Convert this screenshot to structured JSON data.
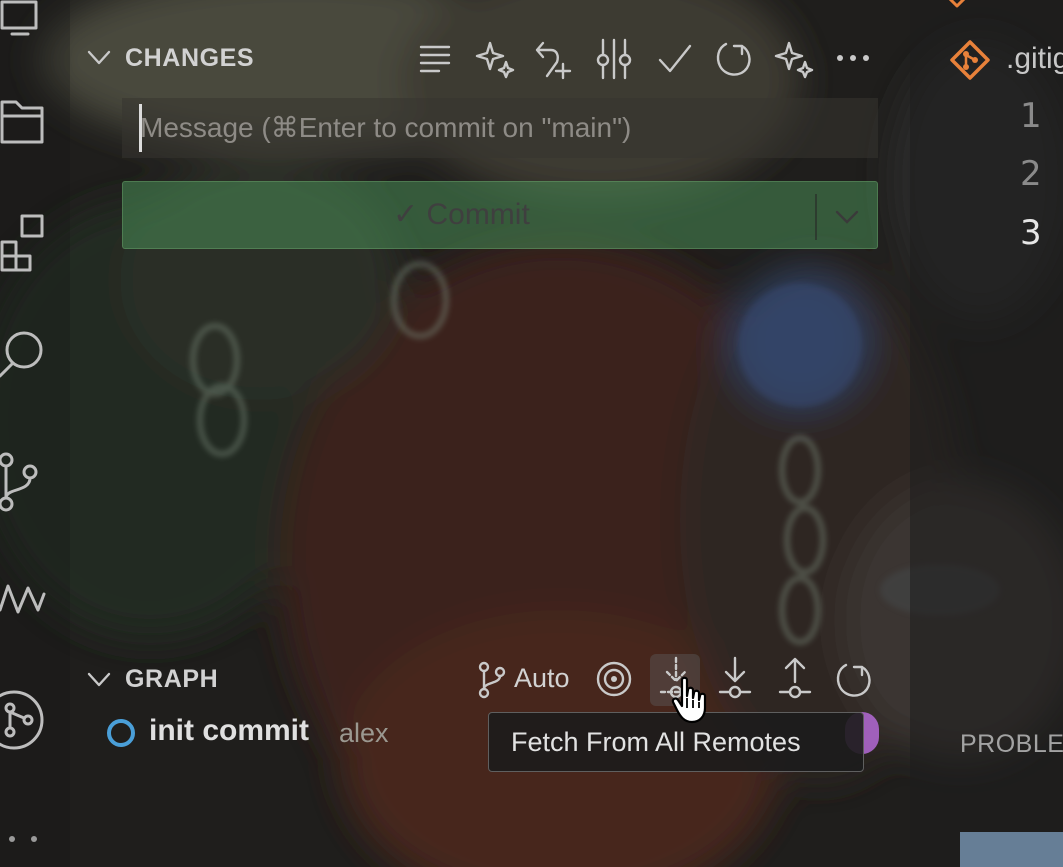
{
  "changes": {
    "title": "CHANGES",
    "toolbar_icons": [
      "list-flat-icon",
      "sparkle-icon",
      "discard-icon",
      "stage-commit-icon",
      "checkmark-icon",
      "refresh-icon",
      "sparkle-icon",
      "more-icon"
    ],
    "message_placeholder": "Message (⌘Enter to commit on \"main\")",
    "commit_label": "✓ Commit"
  },
  "graph": {
    "title": "GRAPH",
    "branch_mode": "Auto",
    "commits": [
      {
        "message": "init commit",
        "author": "alex"
      }
    ],
    "tooltip": "Fetch From All Remotes"
  },
  "editor": {
    "tab_label": ".gitig",
    "line_numbers": [
      "1",
      "2",
      "3"
    ]
  },
  "panel": {
    "tab_label": "PROBLE"
  },
  "activity_bar": {
    "icons": [
      "explorer-icon",
      "files-icon",
      "extensions-icon",
      "search-icon",
      "source-control-icon",
      "gitlens-icon",
      "git-graph-icon",
      "more-icon"
    ]
  },
  "colors": {
    "commit_button": "#488c56",
    "commit_dot": "#4a9fd8",
    "accent_purple": "#b46ad6",
    "git_icon": "#e8813a"
  }
}
